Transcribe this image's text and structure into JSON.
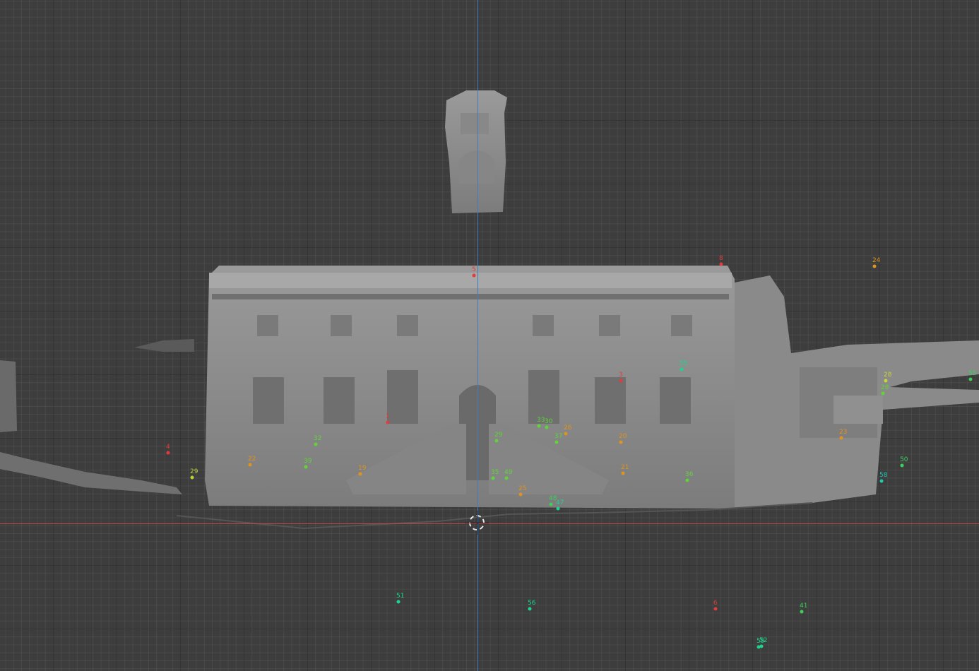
{
  "viewport": {
    "colors": {
      "background": "#3d3d3d",
      "x_axis": "#b8474f",
      "z_axis": "#4a79b8",
      "mesh": "#8a8a8a"
    },
    "markers": [
      {
        "label": "24",
        "color": "#e0931f"
      },
      {
        "label": "8",
        "color": "#e23b3b"
      },
      {
        "label": "55",
        "color": "#1fd38e"
      },
      {
        "label": "28",
        "color": "#c8d43a"
      },
      {
        "label": "55",
        "color": "#3ccf5a"
      },
      {
        "label": "4",
        "color": "#e23b3b"
      },
      {
        "label": "1",
        "color": "#e23b3b"
      },
      {
        "label": "29",
        "color": "#b6d43a"
      },
      {
        "label": "22",
        "color": "#e0931f"
      },
      {
        "label": "32",
        "color": "#5fd438"
      },
      {
        "label": "39",
        "color": "#5fd438"
      },
      {
        "label": "19",
        "color": "#e0931f"
      },
      {
        "label": "35",
        "color": "#5fd438"
      },
      {
        "label": "49",
        "color": "#5fd438"
      },
      {
        "label": "29",
        "color": "#5fd438"
      },
      {
        "label": "33",
        "color": "#5fd438"
      },
      {
        "label": "30",
        "color": "#5fd438"
      },
      {
        "label": "26",
        "color": "#e0931f"
      },
      {
        "label": "37",
        "color": "#5fd438"
      },
      {
        "label": "20",
        "color": "#e0931f"
      },
      {
        "label": "21",
        "color": "#e0931f"
      },
      {
        "label": "25",
        "color": "#e0931f"
      },
      {
        "label": "48",
        "color": "#3ccf5a"
      },
      {
        "label": "47",
        "color": "#1fd38e"
      },
      {
        "label": "36",
        "color": "#5fd438"
      },
      {
        "label": "23",
        "color": "#e0931f"
      },
      {
        "label": "50",
        "color": "#3ccf5a"
      },
      {
        "label": "58",
        "color": "#1fc9b4"
      },
      {
        "label": "51",
        "color": "#1fd38e"
      },
      {
        "label": "56",
        "color": "#1fd38e"
      },
      {
        "label": "6",
        "color": "#e23b3b"
      },
      {
        "label": "41",
        "color": "#3ccf5a"
      },
      {
        "label": "52",
        "color": "#1fd38e"
      },
      {
        "label": "59",
        "color": "#1fd38e"
      },
      {
        "label": "28",
        "color": "#5fd438"
      },
      {
        "label": "5",
        "color": "#e23b3b"
      },
      {
        "label": "3",
        "color": "#e23b3b"
      }
    ]
  }
}
